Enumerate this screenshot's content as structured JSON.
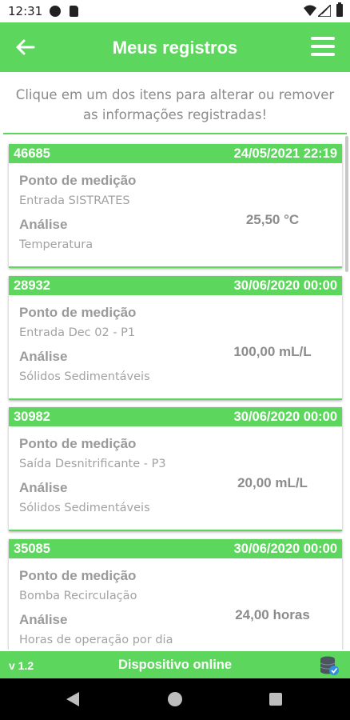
{
  "status_bar": {
    "time": "12:31"
  },
  "header": {
    "title": "Meus registros"
  },
  "hint": {
    "line1": "Clique em um dos itens para alterar ou remover",
    "line2": "as informações registradas!"
  },
  "labels": {
    "point": "Ponto de medição",
    "analysis": "Análise"
  },
  "records": [
    {
      "id": "46685",
      "datetime": "24/05/2021 22:19",
      "point": "Entrada SISTRATES",
      "analysis": "Temperatura",
      "value": "25,50 °C"
    },
    {
      "id": "28932",
      "datetime": "30/06/2020 00:00",
      "point": "Entrada Dec 02 - P1",
      "analysis": "Sólidos Sedimentáveis",
      "value": "100,00 mL/L"
    },
    {
      "id": "30982",
      "datetime": "30/06/2020 00:00",
      "point": "Saída Desnitrificante - P3",
      "analysis": "Sólidos Sedimentáveis",
      "value": "20,00 mL/L"
    },
    {
      "id": "35085",
      "datetime": "30/06/2020 00:00",
      "point": "Bomba Recirculação",
      "analysis": "Horas de operação por dia",
      "value": "24,00 horas"
    }
  ],
  "footer": {
    "version": "v 1.2",
    "status": "Dispositivo online"
  },
  "colors": {
    "accent": "#5cd65c",
    "text_muted": "#9a9a9a"
  },
  "icons": {
    "back": "arrow-left-icon",
    "menu": "hamburger-menu-icon",
    "db_status": "database-check-icon"
  }
}
